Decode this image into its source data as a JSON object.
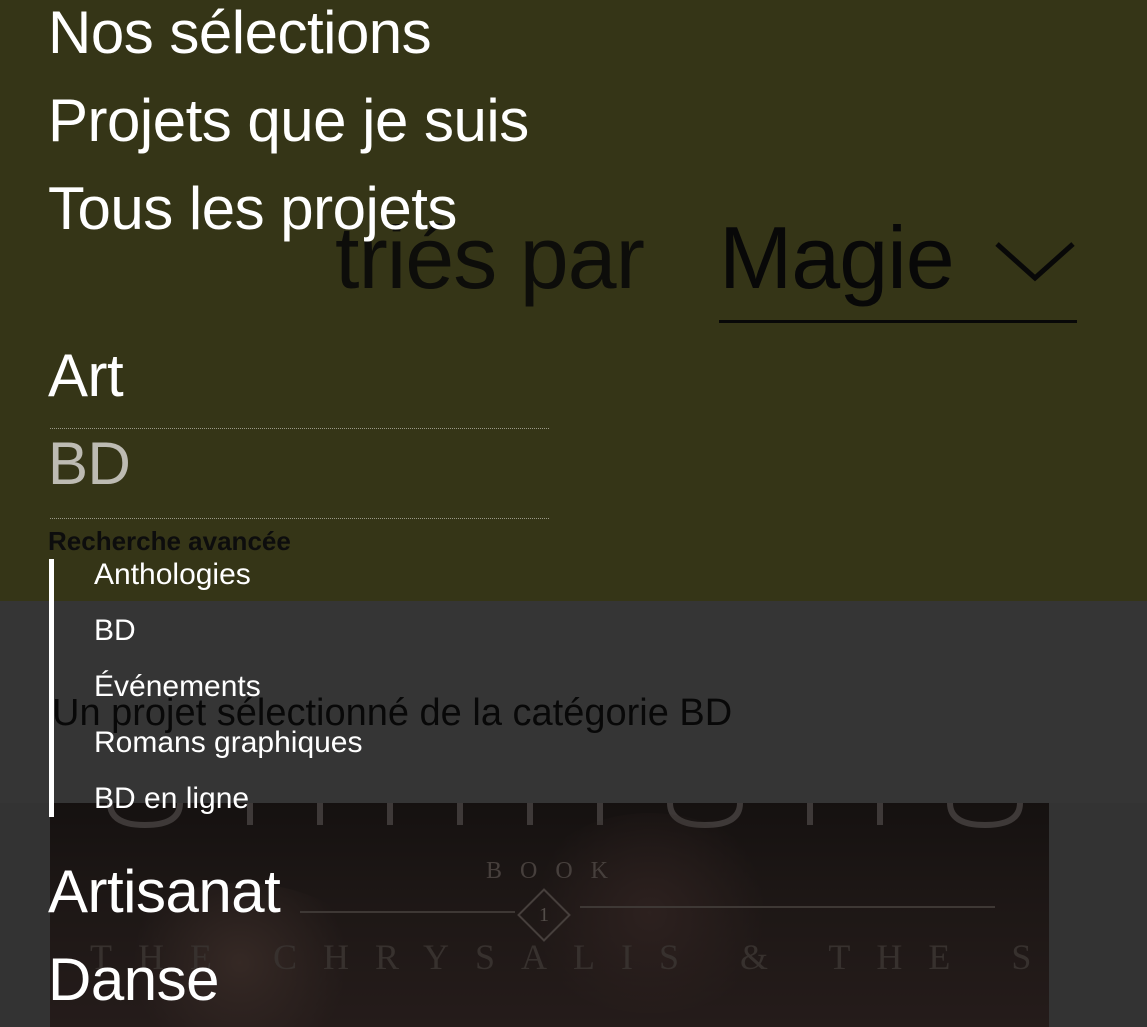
{
  "sort": {
    "label": "triés par",
    "selected": "Magie",
    "chevron_icon": "chevron-down-icon"
  },
  "selected_banner": "Un projet sélectionné de la catégorie BD",
  "cover": {
    "book_label": "BOOK",
    "book_number": "1",
    "subtitle": "THE CHRYSALIS & THE STONE"
  },
  "menu": {
    "top_links": [
      "Nos sélections",
      "Projets que je suis",
      "Tous les projets"
    ],
    "categories": {
      "art": "Art",
      "bd": "BD",
      "advanced_search": "Recherche avancée",
      "subcategories": [
        "Anthologies",
        "BD",
        "Événements",
        "Romans graphiques",
        "BD en ligne"
      ],
      "artisanat": "Artisanat",
      "danse": "Danse"
    }
  }
}
